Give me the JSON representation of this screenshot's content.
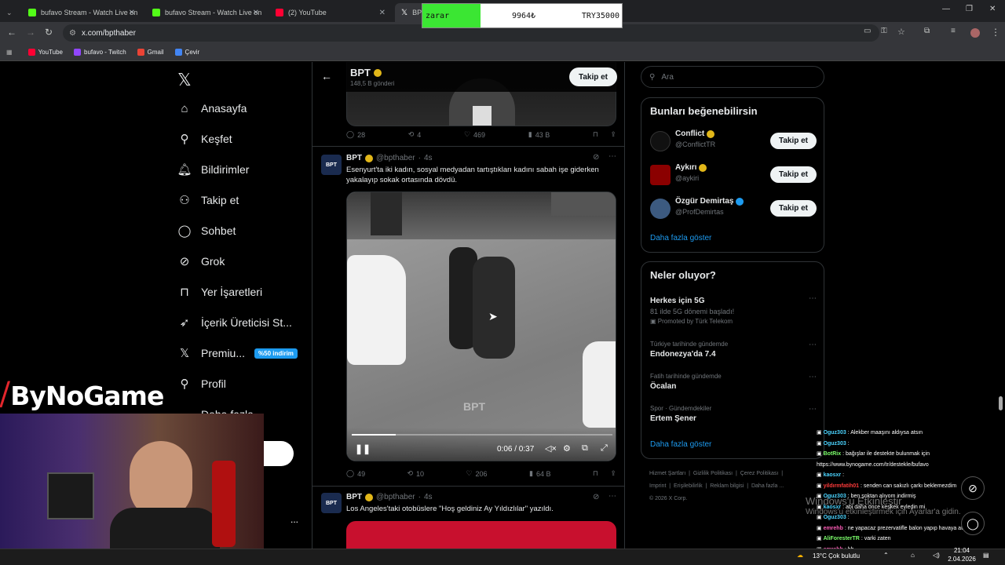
{
  "browser": {
    "tabs": [
      {
        "title": "bufavo Stream - Watch Live on",
        "color": "#53fc18"
      },
      {
        "title": "bufavo Stream - Watch Live on",
        "color": "#53fc18"
      },
      {
        "title": "(2) YouTube",
        "color": "#ff0033"
      },
      {
        "title": "BPT",
        "color": "#000000"
      }
    ],
    "url": "x.com/bpthaber",
    "bookmarks": [
      "YouTube",
      "bufavo - Twitch",
      "Gmail",
      "Çevir"
    ]
  },
  "overlay": {
    "label": "zarar",
    "middle": "9964₺",
    "right": "TRY35000",
    "brand": "ByNoGame",
    "more_dots": "..."
  },
  "sidebar": {
    "items": [
      {
        "label": "Anasayfa",
        "icon": "home-icon"
      },
      {
        "label": "Keşfet",
        "icon": "search-icon"
      },
      {
        "label": "Bildirimler",
        "icon": "bell-icon"
      },
      {
        "label": "Takip et",
        "icon": "person-add-icon"
      },
      {
        "label": "Sohbet",
        "icon": "chat-icon"
      },
      {
        "label": "Grok",
        "icon": "grok-icon"
      },
      {
        "label": "Yer İşaretleri",
        "icon": "bookmark-icon"
      },
      {
        "label": "İçerik Üreticisi St...",
        "icon": "rocket-icon"
      },
      {
        "label": "Premiu...",
        "icon": "x-logo-icon"
      },
      {
        "label": "Profil",
        "icon": "person-icon"
      },
      {
        "label": "Daha fazla",
        "icon": "more-icon"
      }
    ],
    "premium_badge": "%50 indirim"
  },
  "profile_header": {
    "name": "BPT",
    "posts": "148,5 B gönderi",
    "follow_label": "Takip et"
  },
  "tweets": [
    {
      "stats": {
        "replies": "28",
        "reposts": "4",
        "likes": "469",
        "views": "43 B"
      }
    },
    {
      "name": "BPT",
      "handle": "@bpthaber",
      "time": "4s",
      "text": "Esenyurt'ta iki kadın, sosyal medyadan tartıştıkları kadını sabah işe giderken yakalayıp sokak ortasında dövdü.",
      "video_time": "0:06 / 0:37",
      "video_progress": 0.17,
      "watermark": "BPT",
      "stats": {
        "replies": "49",
        "reposts": "10",
        "likes": "206",
        "views": "64 B"
      }
    },
    {
      "name": "BPT",
      "handle": "@bpthaber",
      "time": "4s",
      "text": "Los Angeles'taki otobüslere \"Hoş geldiniz Ay Yıldızlılar\" yazıldı."
    }
  ],
  "right": {
    "search_placeholder": "Ara",
    "suggest_title": "Bunları beğenebilirsin",
    "suggestions": [
      {
        "name": "Conflict",
        "handle": "@ConflictTR",
        "btn": "Takip et"
      },
      {
        "name": "Aykırı",
        "handle": "@aykiri",
        "btn": "Takip et"
      },
      {
        "name": "Özgür Demirtaş",
        "handle": "@ProfDemirtas",
        "btn": "Takip et"
      }
    ],
    "show_more": "Daha fazla göster",
    "trends_title": "Neler oluyor?",
    "trends": [
      {
        "context": "",
        "title": "Herkes için 5G",
        "sub": "81 ilde 5G dönemi başladı!",
        "promo": "Promoted by Türk Telekom"
      },
      {
        "context": "Türkiye tarihinde gündemde",
        "title": "Endonezya'da 7.4"
      },
      {
        "context": "Fatih tarihinde gündemde",
        "title": "Öcalan"
      },
      {
        "context": "Spor · Gündemdekiler",
        "title": "Ertem Şener"
      }
    ],
    "trends_more": "Daha fazla göster",
    "footer": [
      "Hizmet Şartları",
      "Gizlilik Politikası",
      "Çerez Politikası",
      "Imprint",
      "Erişilebilirlik",
      "Reklam bilgisi",
      "Daha fazla ...",
      "© 2026 X Corp."
    ]
  },
  "chat": [
    {
      "user": "Oguz303",
      "msg": ": Alekber maaşını aldıysa atsın",
      "cls": "u"
    },
    {
      "user": "Oguz303",
      "msg": ":",
      "cls": "u"
    },
    {
      "user": "BotRix",
      "msg": ": bağışlar ile destekte bulunmak için https://www.bynogame.com/tr/destekle/bufavo",
      "cls": "u4"
    },
    {
      "user": "kaosxr",
      "msg": ":",
      "cls": "u"
    },
    {
      "user": "yildırmfatih01",
      "msg": ": senden can sakızlı çarkı beklemezdim",
      "cls": "u3"
    },
    {
      "user": "Oguz303",
      "msg": ": ben şoktan alıyom indirmiş",
      "cls": "u"
    },
    {
      "user": "kaosxr",
      "msg": ": abi daha önce keşkek eyledin mi",
      "cls": "u"
    },
    {
      "user": "Oguz303",
      "msg": ":",
      "cls": "u"
    },
    {
      "user": "emrehb",
      "msg": ": ne yapacaz prezervatifle balon yapıp havaya atacaz",
      "cls": "u2"
    },
    {
      "user": "AliForesterTR",
      "msg": ": varki zaten",
      "cls": "u4"
    },
    {
      "user": "emrehb",
      "msg": ": hb",
      "cls": "u2"
    }
  ],
  "windows": {
    "watermark_line1": "Windows'u Etkinleştir",
    "watermark_line2": "Windows'u etkinleştirmek için Ayarlar'a gidin.",
    "weather": "13°C  Çok bulutlu",
    "time": "21:04",
    "date": "2.04.2026"
  }
}
